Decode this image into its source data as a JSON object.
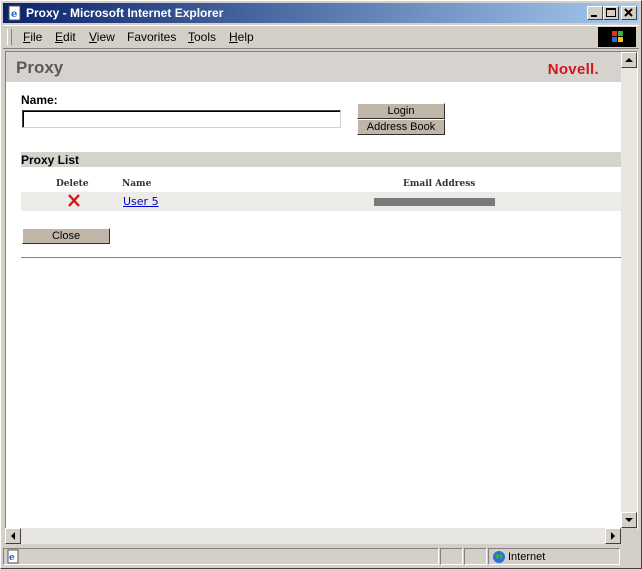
{
  "window": {
    "title": "Proxy - Microsoft Internet Explorer"
  },
  "menu": {
    "items": [
      {
        "key": "F",
        "rest": "ile"
      },
      {
        "key": "E",
        "rest": "dit"
      },
      {
        "key": "V",
        "rest": "iew"
      },
      {
        "key": "",
        "rest": "Favorites"
      },
      {
        "key": "T",
        "rest": "ools"
      },
      {
        "key": "H",
        "rest": "elp"
      }
    ]
  },
  "page": {
    "title": "Proxy",
    "brand": "Novell."
  },
  "form": {
    "name_label": "Name:",
    "name_value": "",
    "login_label": "Login",
    "address_book_label": "Address Book"
  },
  "proxy_list": {
    "heading": "Proxy List",
    "columns": [
      "Delete",
      "Name",
      "Email Address"
    ],
    "rows": [
      {
        "name": "User 5",
        "email": "[redacted]"
      }
    ]
  },
  "close_label": "Close",
  "status": {
    "zone": "Internet"
  },
  "colors": {
    "brand": "#d0151b",
    "link": "#0000cc",
    "titlebar_start": "#0a246a"
  },
  "icons": [
    "ie-page-icon",
    "minimize-icon",
    "maximize-icon",
    "close-icon",
    "windows-logo-icon",
    "delete-x-icon",
    "internet-globe-icon"
  ]
}
